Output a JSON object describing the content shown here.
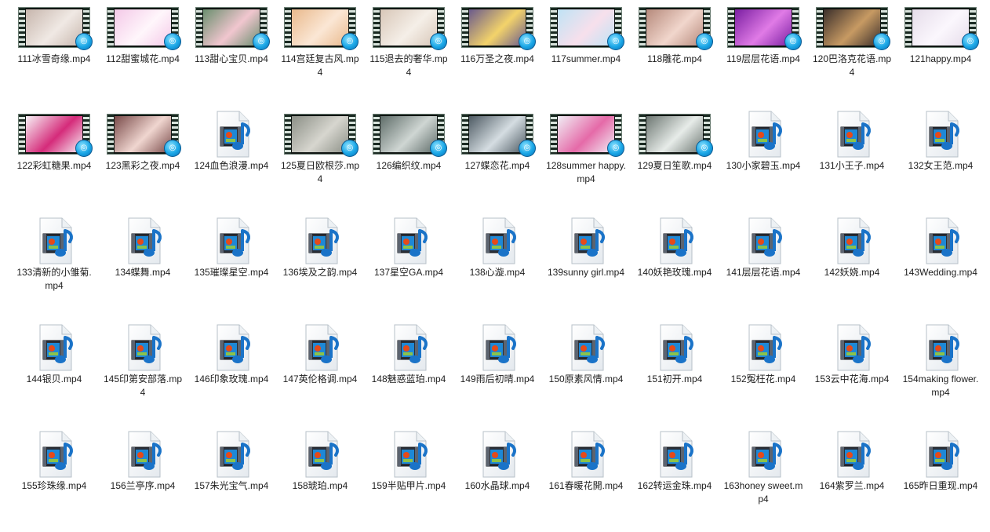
{
  "files": [
    {
      "name": "111冰雪奇缘.mp4",
      "thumb": "video",
      "colors": [
        "#c7b6ad",
        "#f0e9e4"
      ]
    },
    {
      "name": "112甜蜜城花.mp4",
      "thumb": "video",
      "colors": [
        "#f4c9e8",
        "#fff6fb"
      ]
    },
    {
      "name": "113甜心宝贝.mp4",
      "thumb": "video",
      "colors": [
        "#6b8f6f",
        "#f1c6cf"
      ]
    },
    {
      "name": "114宫廷复古风.mp4",
      "thumb": "video",
      "colors": [
        "#e9b98c",
        "#fbe7d5"
      ]
    },
    {
      "name": "115退去的奢华.mp4",
      "thumb": "video",
      "colors": [
        "#d8c7b8",
        "#f5efe8"
      ]
    },
    {
      "name": "116万圣之夜.mp4",
      "thumb": "video",
      "colors": [
        "#6a5a8c",
        "#f3d36a"
      ]
    },
    {
      "name": "117summer.mp4",
      "thumb": "video",
      "colors": [
        "#bfe3f5",
        "#f7e0ec"
      ]
    },
    {
      "name": "118雕花.mp4",
      "thumb": "video",
      "colors": [
        "#b68a7c",
        "#f1d6cc"
      ]
    },
    {
      "name": "119层层花语.mp4",
      "thumb": "video",
      "colors": [
        "#7b1fa2",
        "#e07be6"
      ]
    },
    {
      "name": "120巴洛克花语.mp4",
      "thumb": "video",
      "colors": [
        "#3b2f2b",
        "#c79a63"
      ]
    },
    {
      "name": "121happy.mp4",
      "thumb": "video",
      "colors": [
        "#e6ddea",
        "#fbf7fd"
      ]
    },
    {
      "name": "122彩虹糖果.mp4",
      "thumb": "video",
      "colors": [
        "#f7f2f6",
        "#d52b7a"
      ]
    },
    {
      "name": "123黑彩之夜.mp4",
      "thumb": "video",
      "colors": [
        "#7a4b4a",
        "#f0d6d0"
      ]
    },
    {
      "name": "124血色浪漫.mp4",
      "thumb": "file"
    },
    {
      "name": "125夏日欧根莎.mp4",
      "thumb": "video",
      "colors": [
        "#8b8f86",
        "#d7d6cf"
      ]
    },
    {
      "name": "126编织纹.mp4",
      "thumb": "video",
      "colors": [
        "#5f6d69",
        "#cfd6d3"
      ]
    },
    {
      "name": "127蝶恋花.mp4",
      "thumb": "video",
      "colors": [
        "#4d5a62",
        "#d5dde2"
      ]
    },
    {
      "name": "128summer happy.mp4",
      "thumb": "video",
      "colors": [
        "#f1eff5",
        "#e56aa8"
      ]
    },
    {
      "name": "129夏日笙歌.mp4",
      "thumb": "video",
      "colors": [
        "#6d7772",
        "#e7ece9"
      ]
    },
    {
      "name": "130小家碧玉.mp4",
      "thumb": "file"
    },
    {
      "name": "131小王子.mp4",
      "thumb": "file"
    },
    {
      "name": "132女王范.mp4",
      "thumb": "file"
    },
    {
      "name": "133清新的小雏菊.mp4",
      "thumb": "file"
    },
    {
      "name": "134蝶舞.mp4",
      "thumb": "file"
    },
    {
      "name": "135璀璨星空.mp4",
      "thumb": "file"
    },
    {
      "name": "136埃及之韵.mp4",
      "thumb": "file"
    },
    {
      "name": "137星空GA.mp4",
      "thumb": "file"
    },
    {
      "name": "138心漩.mp4",
      "thumb": "file"
    },
    {
      "name": "139sunny girl.mp4",
      "thumb": "file"
    },
    {
      "name": "140妖艳玫瑰.mp4",
      "thumb": "file"
    },
    {
      "name": "141层层花语.mp4",
      "thumb": "file"
    },
    {
      "name": "142妖娆.mp4",
      "thumb": "file"
    },
    {
      "name": "143Wedding.mp4",
      "thumb": "file"
    },
    {
      "name": "144银贝.mp4",
      "thumb": "file"
    },
    {
      "name": "145印第安部落.mp4",
      "thumb": "file"
    },
    {
      "name": "146印象玫瑰.mp4",
      "thumb": "file"
    },
    {
      "name": "147英伦格调.mp4",
      "thumb": "file"
    },
    {
      "name": "148魅惑蓝珀.mp4",
      "thumb": "file"
    },
    {
      "name": "149雨后初晴.mp4",
      "thumb": "file"
    },
    {
      "name": "150原素风情.mp4",
      "thumb": "file"
    },
    {
      "name": "151初开.mp4",
      "thumb": "file"
    },
    {
      "name": "152冤枉花.mp4",
      "thumb": "file"
    },
    {
      "name": "153云中花海.mp4",
      "thumb": "file"
    },
    {
      "name": "154making flower.mp4",
      "thumb": "file"
    },
    {
      "name": "155珍珠缘.mp4",
      "thumb": "file"
    },
    {
      "name": "156兰亭序.mp4",
      "thumb": "file"
    },
    {
      "name": "157朱光宝气.mp4",
      "thumb": "file"
    },
    {
      "name": "158琥珀.mp4",
      "thumb": "file"
    },
    {
      "name": "159半贴甲片.mp4",
      "thumb": "file"
    },
    {
      "name": "160水晶球.mp4",
      "thumb": "file"
    },
    {
      "name": "161春暖花開.mp4",
      "thumb": "file"
    },
    {
      "name": "162转运金珠.mp4",
      "thumb": "file"
    },
    {
      "name": "163honey sweet.mp4",
      "thumb": "file"
    },
    {
      "name": "164紫罗兰.mp4",
      "thumb": "file"
    },
    {
      "name": "165昨日重现.mp4",
      "thumb": "file"
    }
  ]
}
